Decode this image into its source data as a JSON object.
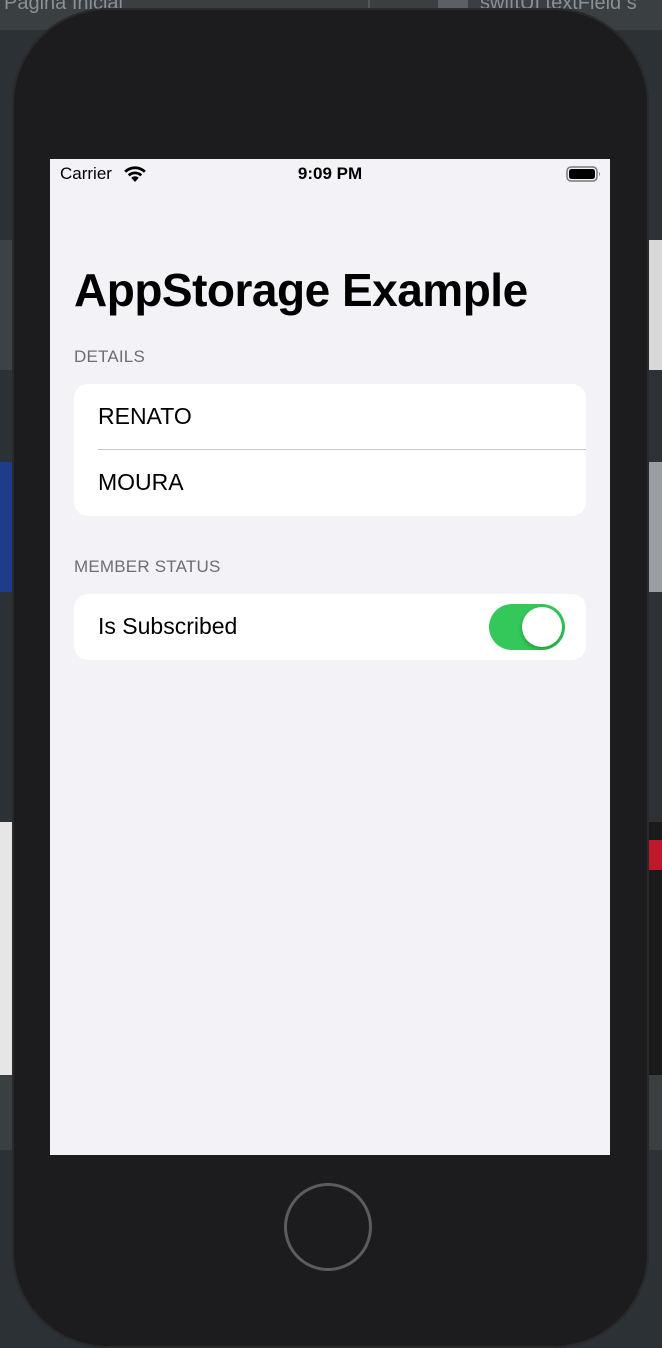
{
  "browser": {
    "left_tab_text": "Página Inicial",
    "right_tab_text": "swiftUI textField s"
  },
  "status_bar": {
    "carrier": "Carrier",
    "time": "9:09 PM"
  },
  "app": {
    "title": "AppStorage Example",
    "details_header": "DETAILS",
    "first_name": "RENATO",
    "last_name": "MOURA",
    "member_header": "MEMBER STATUS",
    "subscribed_label": "Is Subscribed",
    "subscribed_on": true
  },
  "colors": {
    "toggle_on": "#34c759",
    "screen_bg": "#f2f2f7"
  },
  "icons": [
    "wifi-icon",
    "battery-icon",
    "home-button"
  ]
}
